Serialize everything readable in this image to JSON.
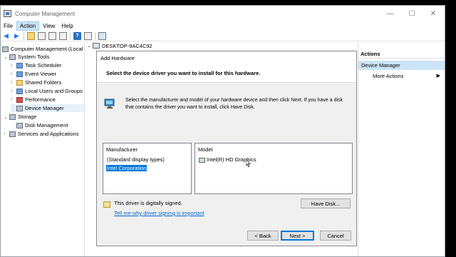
{
  "window": {
    "title": "Computer Management",
    "minimize_glyph": "—",
    "maximize_glyph": "☐",
    "close_glyph": "✕"
  },
  "menu": [
    "File",
    "Action",
    "View",
    "Help"
  ],
  "toolbar": {
    "icons": [
      "back-arrow-icon",
      "forward-arrow-icon",
      "up-folder-icon",
      "properties-icon",
      "show-hide-tree-icon",
      "export-icon",
      "help-icon",
      "console-icon",
      "computer-icon"
    ]
  },
  "tree": {
    "items": [
      {
        "label": "Computer Management (Local",
        "level": 0,
        "chevron": ""
      },
      {
        "label": "System Tools",
        "level": 1,
        "chevron": "⌄"
      },
      {
        "label": "Task Scheduler",
        "level": 2,
        "chevron": "›"
      },
      {
        "label": "Event Viewer",
        "level": 2,
        "chevron": "›"
      },
      {
        "label": "Shared Folders",
        "level": 2,
        "chevron": "›"
      },
      {
        "label": "Local Users and Groups",
        "level": 2,
        "chevron": "›"
      },
      {
        "label": "Performance",
        "level": 2,
        "chevron": "›"
      },
      {
        "label": "Device Manager",
        "level": 2,
        "chevron": ""
      },
      {
        "label": "Storage",
        "level": 1,
        "chevron": "⌄"
      },
      {
        "label": "Disk Management",
        "level": 2,
        "chevron": ""
      },
      {
        "label": "Services and Applications",
        "level": 1,
        "chevron": "›"
      }
    ]
  },
  "center": {
    "root_label": "DESKTOP-9AC4C92"
  },
  "dialog": {
    "title": "Add Hardware",
    "heading": "Select the device driver you want to install for this hardware.",
    "instructions": "Select the manufacturer and model of your hardware device and then click Next. If you have a disk that contains the driver you want to install, click Have Disk.",
    "manufacturer_header": "Manufacturer",
    "manufacturers": [
      "(Standard display types)",
      "Intel Corporation"
    ],
    "selected_manufacturer": "Intel Corporation",
    "model_header": "Model",
    "models": [
      "Intel(R) HD Graphics"
    ],
    "signed_text": "This driver is digitally signed.",
    "signing_link": "Tell me why driver signing is important",
    "have_disk_label": "Have Disk...",
    "back_label": "< Back",
    "next_label": "Next >",
    "cancel_label": "Cancel"
  },
  "actions": {
    "header": "Actions",
    "selected": "Device Manager",
    "more_actions": "More Actions",
    "more_arrow": "▶"
  }
}
